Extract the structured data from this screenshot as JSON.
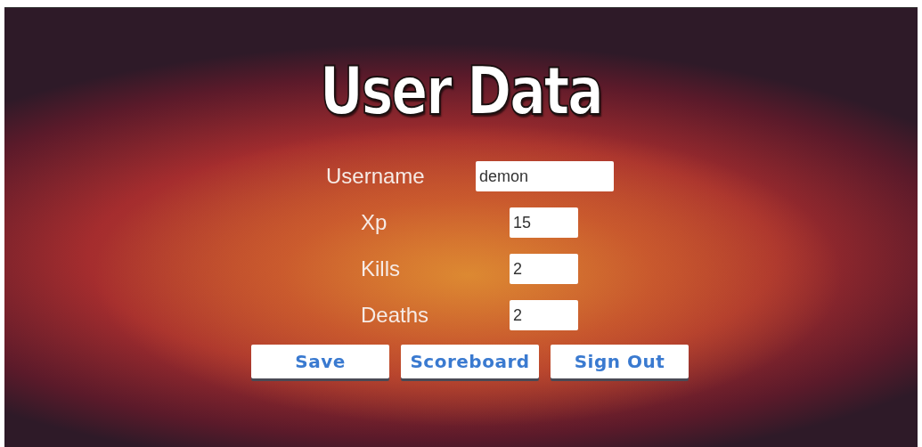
{
  "title": "User Data",
  "fields": [
    {
      "label": "Username",
      "value": "demon",
      "kind": "wide"
    },
    {
      "label": "Xp",
      "value": "15",
      "kind": "short"
    },
    {
      "label": "Kills",
      "value": "2",
      "kind": "short"
    },
    {
      "label": "Deaths",
      "value": "2",
      "kind": "short"
    }
  ],
  "buttons": [
    "Save",
    "Scoreboard",
    "Sign Out"
  ]
}
